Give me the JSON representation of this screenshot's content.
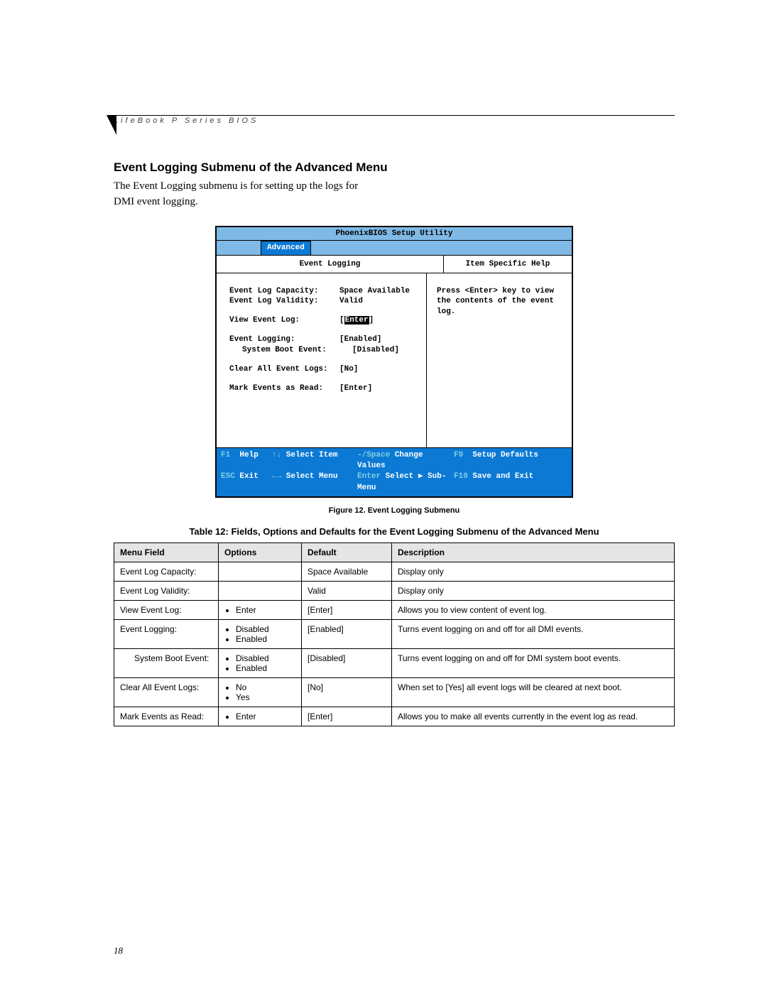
{
  "doc": {
    "header": "LifeBook P Series BIOS",
    "page_number": "18",
    "section_title": "Event Logging Submenu of the Advanced Menu",
    "section_body": "The Event Logging submenu is for setting up the logs for DMI event logging."
  },
  "bios": {
    "title": "PhoenixBIOS Setup Utility",
    "tab": "Advanced",
    "left_heading": "Event Logging",
    "right_heading": "Item Specific Help",
    "help_text": "Press <Enter> key to view the contents of the event log.",
    "fields": {
      "capacity_label": "Event Log Capacity:",
      "capacity_value": "Space Available",
      "validity_label": "Event Log Validity:",
      "validity_value": "Valid",
      "view_label": "View Event Log:",
      "view_value": "Enter",
      "logging_label": "Event Logging:",
      "logging_value": "[Enabled]",
      "boot_label": "System Boot Event:",
      "boot_value": "[Disabled]",
      "clear_label": "Clear All Event Logs:",
      "clear_value": "[No]",
      "mark_label": "Mark Events as Read:",
      "mark_value": "[Enter]"
    },
    "footer": {
      "f1": "F1",
      "help": "Help",
      "arrows_ud": "↑↓",
      "select_item": "Select Item",
      "minus_space": "-/Space",
      "change_values": "Change Values",
      "f9": "F9",
      "setup_defaults": "Setup Defaults",
      "esc": "ESC",
      "exit": "Exit",
      "arrows_lr": "←→",
      "select_menu": "Select Menu",
      "enter": "Enter",
      "select_sub": "Select ▶ Sub-Menu",
      "f10": "F10",
      "save_exit": "Save and Exit"
    }
  },
  "figure_caption": "Figure 12.  Event Logging Submenu",
  "table_title": "Table 12: Fields, Options and Defaults for the Event Logging Submenu of the Advanced Menu",
  "table": {
    "headers": {
      "menu_field": "Menu Field",
      "options": "Options",
      "default": "Default",
      "description": "Description"
    },
    "rows": [
      {
        "field": "Event Log Capacity:",
        "options": [],
        "default": "Space Available",
        "desc": "Display only",
        "indent": false
      },
      {
        "field": "Event Log Validity:",
        "options": [],
        "default": "Valid",
        "desc": "Display only",
        "indent": false
      },
      {
        "field": "View Event Log:",
        "options": [
          "Enter"
        ],
        "default": "[Enter]",
        "desc": "Allows you to view content of event log.",
        "indent": false
      },
      {
        "field": "Event Logging:",
        "options": [
          "Disabled",
          "Enabled"
        ],
        "default": "[Enabled]",
        "desc": "Turns event logging on and off for all DMI events.",
        "indent": false
      },
      {
        "field": "System Boot Event:",
        "options": [
          "Disabled",
          "Enabled"
        ],
        "default": "[Disabled]",
        "desc": "Turns event logging on and off for DMI system boot events.",
        "indent": true
      },
      {
        "field": "Clear All Event Logs:",
        "options": [
          "No",
          "Yes"
        ],
        "default": "[No]",
        "desc": "When set to [Yes] all event logs will be cleared at next boot.",
        "indent": false
      },
      {
        "field": "Mark Events as Read:",
        "options": [
          "Enter"
        ],
        "default": "[Enter]",
        "desc": "Allows you to make all events currently in the event log as read.",
        "indent": false
      }
    ]
  }
}
